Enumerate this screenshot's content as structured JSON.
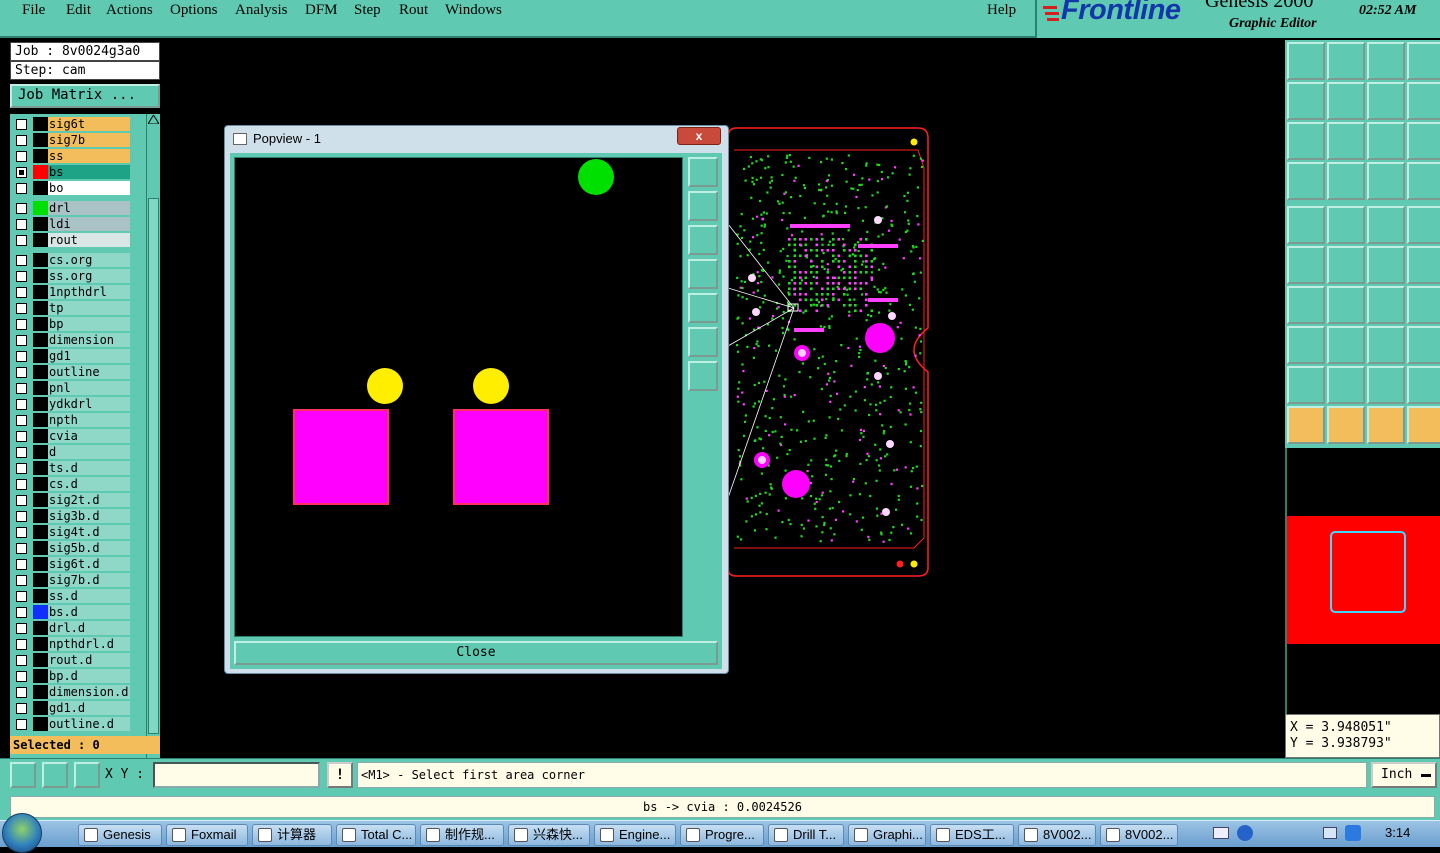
{
  "menubar": {
    "items": [
      "File",
      "Edit",
      "Actions",
      "Options",
      "Analysis",
      "DFM",
      "Step",
      "Rout",
      "Windows"
    ],
    "help": "Help"
  },
  "brand": {
    "logo": "Frontline",
    "product": "Genesis 2000",
    "subtitle": "Graphic Editor",
    "clock": "02:52 AM"
  },
  "job": {
    "job_label": "Job : 8v0024g3a0",
    "step_label": "Step: cam",
    "matrix_button": "Job Matrix ..."
  },
  "layers": [
    {
      "name": "sig6t",
      "color": "#f3bd5b",
      "swatch": "#000000",
      "checked": false
    },
    {
      "name": "sig7b",
      "color": "#f3bd5b",
      "swatch": "#000000",
      "checked": false
    },
    {
      "name": "ss",
      "color": "#f3bd5b",
      "swatch": "#000000",
      "checked": false
    },
    {
      "name": "bs",
      "color": "#1ea386",
      "swatch": "#ff0000",
      "checked": true
    },
    {
      "name": "bo",
      "color": "#ffffff",
      "swatch": "#000000",
      "checked": false
    },
    {
      "name": "drl",
      "color": "#a9c2c5",
      "swatch": "#00e000",
      "checked": false
    },
    {
      "name": "ldi",
      "color": "#a9c2c5",
      "swatch": "#000000",
      "checked": false
    },
    {
      "name": "rout",
      "color": "#d9e6e6",
      "swatch": "#000000",
      "checked": false
    },
    {
      "name": "cs.org",
      "color": "#8fd8c8",
      "swatch": "#000000",
      "checked": false
    },
    {
      "name": "ss.org",
      "color": "#8fd8c8",
      "swatch": "#000000",
      "checked": false
    },
    {
      "name": "1npthdrl",
      "color": "#8fd8c8",
      "swatch": "#000000",
      "checked": false
    },
    {
      "name": "tp",
      "color": "#8fd8c8",
      "swatch": "#000000",
      "checked": false
    },
    {
      "name": "bp",
      "color": "#8fd8c8",
      "swatch": "#000000",
      "checked": false
    },
    {
      "name": "dimension",
      "color": "#8fd8c8",
      "swatch": "#000000",
      "checked": false
    },
    {
      "name": "gd1",
      "color": "#8fd8c8",
      "swatch": "#000000",
      "checked": false
    },
    {
      "name": "outline",
      "color": "#8fd8c8",
      "swatch": "#000000",
      "checked": false
    },
    {
      "name": "pnl",
      "color": "#8fd8c8",
      "swatch": "#000000",
      "checked": false
    },
    {
      "name": "ydkdrl",
      "color": "#8fd8c8",
      "swatch": "#000000",
      "checked": false
    },
    {
      "name": "npth",
      "color": "#8fd8c8",
      "swatch": "#000000",
      "checked": false
    },
    {
      "name": "cvia",
      "color": "#8fd8c8",
      "swatch": "#000000",
      "checked": false
    },
    {
      "name": "d",
      "color": "#8fd8c8",
      "swatch": "#000000",
      "checked": false
    },
    {
      "name": "ts.d",
      "color": "#8fd8c8",
      "swatch": "#000000",
      "checked": false
    },
    {
      "name": "cs.d",
      "color": "#8fd8c8",
      "swatch": "#000000",
      "checked": false
    },
    {
      "name": "sig2t.d",
      "color": "#8fd8c8",
      "swatch": "#000000",
      "checked": false
    },
    {
      "name": "sig3b.d",
      "color": "#8fd8c8",
      "swatch": "#000000",
      "checked": false
    },
    {
      "name": "sig4t.d",
      "color": "#8fd8c8",
      "swatch": "#000000",
      "checked": false
    },
    {
      "name": "sig5b.d",
      "color": "#8fd8c8",
      "swatch": "#000000",
      "checked": false
    },
    {
      "name": "sig6t.d",
      "color": "#8fd8c8",
      "swatch": "#000000",
      "checked": false
    },
    {
      "name": "sig7b.d",
      "color": "#8fd8c8",
      "swatch": "#000000",
      "checked": false
    },
    {
      "name": "ss.d",
      "color": "#8fd8c8",
      "swatch": "#000000",
      "checked": false
    },
    {
      "name": "bs.d",
      "color": "#8fd8c8",
      "swatch": "#1030ff",
      "checked": false
    },
    {
      "name": "drl.d",
      "color": "#8fd8c8",
      "swatch": "#000000",
      "checked": false
    },
    {
      "name": "npthdrl.d",
      "color": "#8fd8c8",
      "swatch": "#000000",
      "checked": false
    },
    {
      "name": "rout.d",
      "color": "#8fd8c8",
      "swatch": "#000000",
      "checked": false
    },
    {
      "name": "bp.d",
      "color": "#8fd8c8",
      "swatch": "#000000",
      "checked": false
    },
    {
      "name": "dimension.d",
      "color": "#8fd8c8",
      "swatch": "#000000",
      "checked": false
    },
    {
      "name": "gd1.d",
      "color": "#8fd8c8",
      "swatch": "#000000",
      "checked": false
    },
    {
      "name": "outline.d",
      "color": "#8fd8c8",
      "swatch": "#000000",
      "checked": false
    }
  ],
  "selected_label": "Selected : 0",
  "popview": {
    "title": "Popview - 1",
    "close_x": "x",
    "close_button": "Close"
  },
  "coords": {
    "x": "X = 3.948051\"",
    "y": "Y = 3.938793\""
  },
  "cmdbar": {
    "xy_label": "X Y :",
    "xy_value": "",
    "bang": "!",
    "prompt": "<M1> - Select first area corner",
    "units": "Inch"
  },
  "status": "bs -> cvia : 0.0024526",
  "taskbar": {
    "items": [
      "Genesis",
      "Foxmail",
      "计算器",
      "Total C...",
      "制作规...",
      "兴森快...",
      "Engine...",
      "Progre...",
      "Drill T...",
      "Graphi...",
      "EDS工...",
      "8V002...",
      "8V002..."
    ],
    "time": "3:14"
  },
  "colors": {
    "panel": "#5fc9b1",
    "active_layer": "#1ea386",
    "board_outline": "#ff0000",
    "pad": "#ff00ff",
    "drill": "#00c000"
  }
}
